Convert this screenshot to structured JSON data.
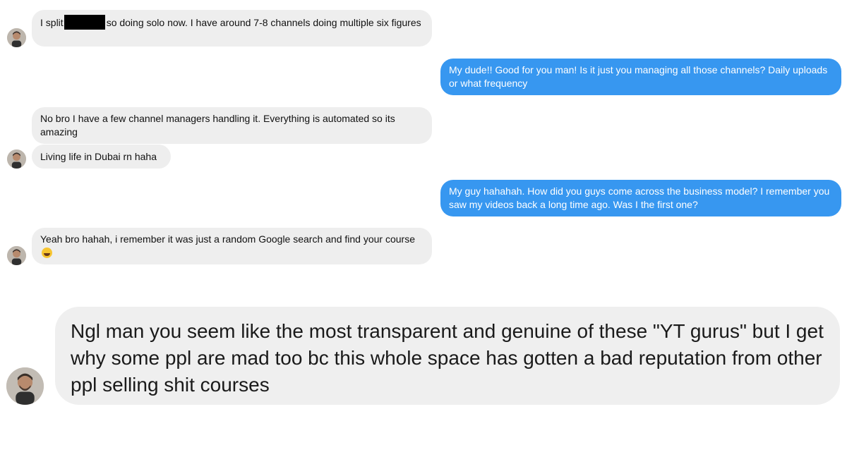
{
  "conversation": {
    "messages": [
      {
        "sender": "them",
        "text_before": "I split",
        "redacted": true,
        "text_after": "so doing solo now. I have around 7-8 channels doing multiple six figures"
      },
      {
        "sender": "me",
        "text": "My dude!! Good for you man! Is it just you managing all those channels? Daily uploads or what frequency"
      },
      {
        "sender": "them",
        "text": "No bro I have a few channel managers handling it. Everything is automated so its amazing"
      },
      {
        "sender": "them",
        "text": "Living life in Dubai rn haha"
      },
      {
        "sender": "me",
        "text": "My guy hahahah. How did you guys come across the business model? I remember you saw my videos back a long time ago. Was I the first one?"
      },
      {
        "sender": "them",
        "text": "Yeah bro hahah, i remember it was just a random Google search and find your course",
        "emoji": "rolling-on-floor-laughing"
      }
    ],
    "highlight": {
      "text": "Ngl man you seem like the most transparent and genuine of these \"YT gurus\" but I get why some ppl are mad too bc this whole space has gotten a bad reputation from other ppl selling shit courses"
    }
  },
  "colors": {
    "incoming_bubble": "#eeeeee",
    "outgoing_bubble": "#3797f0",
    "outgoing_text": "#ffffff",
    "redaction": "#000000"
  },
  "icons": {
    "avatar": "avatar-icon",
    "emoji": "rolling-on-floor-laughing-emoji"
  }
}
